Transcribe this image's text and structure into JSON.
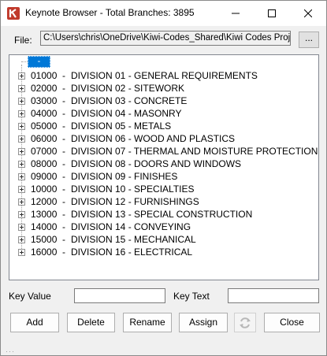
{
  "window": {
    "title": "Keynote Browser - Total Branches: 3895",
    "minimize_icon": "minimize-icon",
    "maximize_icon": "maximize-icon",
    "close_icon": "close-icon"
  },
  "file": {
    "label": "File:",
    "path": "C:\\Users\\chris\\OneDrive\\Kiwi-Codes_Shared\\Kiwi Codes Projects",
    "browse_label": "..."
  },
  "tree": {
    "root_label": "-",
    "items": [
      {
        "code": "01000",
        "sep": "-",
        "name": "DIVISION 01 - GENERAL REQUIREMENTS"
      },
      {
        "code": "02000",
        "sep": "-",
        "name": "DIVISION 02 - SITEWORK"
      },
      {
        "code": "03000",
        "sep": "-",
        "name": "DIVISION 03 - CONCRETE"
      },
      {
        "code": "04000",
        "sep": "-",
        "name": "DIVISION 04 - MASONRY"
      },
      {
        "code": "05000",
        "sep": "-",
        "name": "DIVISION 05 - METALS"
      },
      {
        "code": "06000",
        "sep": "-",
        "name": "DIVISION 06 - WOOD AND PLASTICS"
      },
      {
        "code": "07000",
        "sep": "-",
        "name": "DIVISION 07 - THERMAL AND MOISTURE PROTECTION"
      },
      {
        "code": "08000",
        "sep": "-",
        "name": "DIVISION 08 - DOORS AND WINDOWS"
      },
      {
        "code": "09000",
        "sep": "-",
        "name": "DIVISION 09 - FINISHES"
      },
      {
        "code": "10000",
        "sep": "-",
        "name": "DIVISION 10 - SPECIALTIES"
      },
      {
        "code": "12000",
        "sep": "-",
        "name": "DIVISION 12 - FURNISHINGS"
      },
      {
        "code": "13000",
        "sep": "-",
        "name": "DIVISION 13 - SPECIAL CONSTRUCTION"
      },
      {
        "code": "14000",
        "sep": "-",
        "name": "DIVISION 14 - CONVEYING"
      },
      {
        "code": "15000",
        "sep": "-",
        "name": "DIVISION 15 - MECHANICAL"
      },
      {
        "code": "16000",
        "sep": "-",
        "name": "DIVISION 16 - ELECTRICAL"
      }
    ]
  },
  "fields": {
    "key_value_label": "Key Value",
    "key_value": "",
    "key_text_label": "Key Text",
    "key_text": ""
  },
  "buttons": {
    "add": "Add",
    "delete": "Delete",
    "rename": "Rename",
    "assign": "Assign",
    "refresh_icon": "refresh-icon",
    "close": "Close"
  },
  "colors": {
    "selection": "#0078d7",
    "app_icon": "#c0392b"
  }
}
